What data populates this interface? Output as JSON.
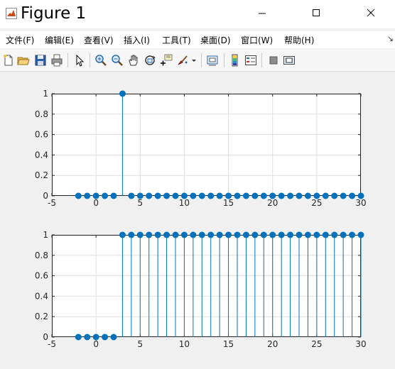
{
  "window": {
    "title": "Figure 1",
    "icon": "matlab-icon",
    "controls": [
      "minimize-icon",
      "maximize-icon",
      "close-icon"
    ]
  },
  "menu": {
    "items": [
      "文件(F)",
      "编辑(E)",
      "查看(V)",
      "插入(I)",
      "工具(T)",
      "桌面(D)",
      "窗口(W)",
      "帮助(H)"
    ],
    "overflow_icon": "arrow-icon"
  },
  "toolbar": {
    "buttons": [
      "new-figure-icon",
      "open-file-icon",
      "save-icon",
      "print-icon",
      "pointer-icon",
      "zoom-in-icon",
      "zoom-out-icon",
      "pan-icon",
      "rotate-3d-icon",
      "data-cursor-icon",
      "brush-icon",
      "brush-dropdown-icon",
      "link-plot-icon",
      "colorbar-icon",
      "legend-icon",
      "hide-plot-tools-icon",
      "show-plot-tools-icon"
    ]
  },
  "colors": {
    "stem": "#0072bd",
    "grid": "#dfdfdf",
    "axes_bg": "#ffffff",
    "figure_bg": "#f0f0f0"
  },
  "chart_data": [
    {
      "type": "stem",
      "x": [
        -2,
        -1,
        0,
        1,
        2,
        3,
        4,
        5,
        6,
        7,
        8,
        9,
        10,
        11,
        12,
        13,
        14,
        15,
        16,
        17,
        18,
        19,
        20,
        21,
        22,
        23,
        24,
        25,
        26,
        27,
        28,
        29,
        30
      ],
      "y": [
        0,
        0,
        0,
        0,
        0,
        1,
        0,
        0,
        0,
        0,
        0,
        0,
        0,
        0,
        0,
        0,
        0,
        0,
        0,
        0,
        0,
        0,
        0,
        0,
        0,
        0,
        0,
        0,
        0,
        0,
        0,
        0,
        0
      ],
      "xlim": [
        -5,
        30
      ],
      "ylim": [
        0,
        1
      ],
      "xticks": [
        "-5",
        "0",
        "5",
        "10",
        "15",
        "20",
        "25",
        "30"
      ],
      "yticks": [
        "0",
        "0.2",
        "0.4",
        "0.6",
        "0.8",
        "1"
      ],
      "grid": true
    },
    {
      "type": "stem",
      "x": [
        -2,
        -1,
        0,
        1,
        2,
        3,
        4,
        5,
        6,
        7,
        8,
        9,
        10,
        11,
        12,
        13,
        14,
        15,
        16,
        17,
        18,
        19,
        20,
        21,
        22,
        23,
        24,
        25,
        26,
        27,
        28,
        29,
        30
      ],
      "y": [
        0,
        0,
        0,
        0,
        0,
        1,
        1,
        1,
        1,
        1,
        1,
        1,
        1,
        1,
        1,
        1,
        1,
        1,
        1,
        1,
        1,
        1,
        1,
        1,
        1,
        1,
        1,
        1,
        1,
        1,
        1,
        1,
        1
      ],
      "xlim": [
        -5,
        30
      ],
      "ylim": [
        0,
        1
      ],
      "xticks": [
        "-5",
        "0",
        "5",
        "10",
        "15",
        "20",
        "25",
        "30"
      ],
      "yticks": [
        "0",
        "0.2",
        "0.4",
        "0.6",
        "0.8",
        "1"
      ],
      "grid": true
    }
  ]
}
